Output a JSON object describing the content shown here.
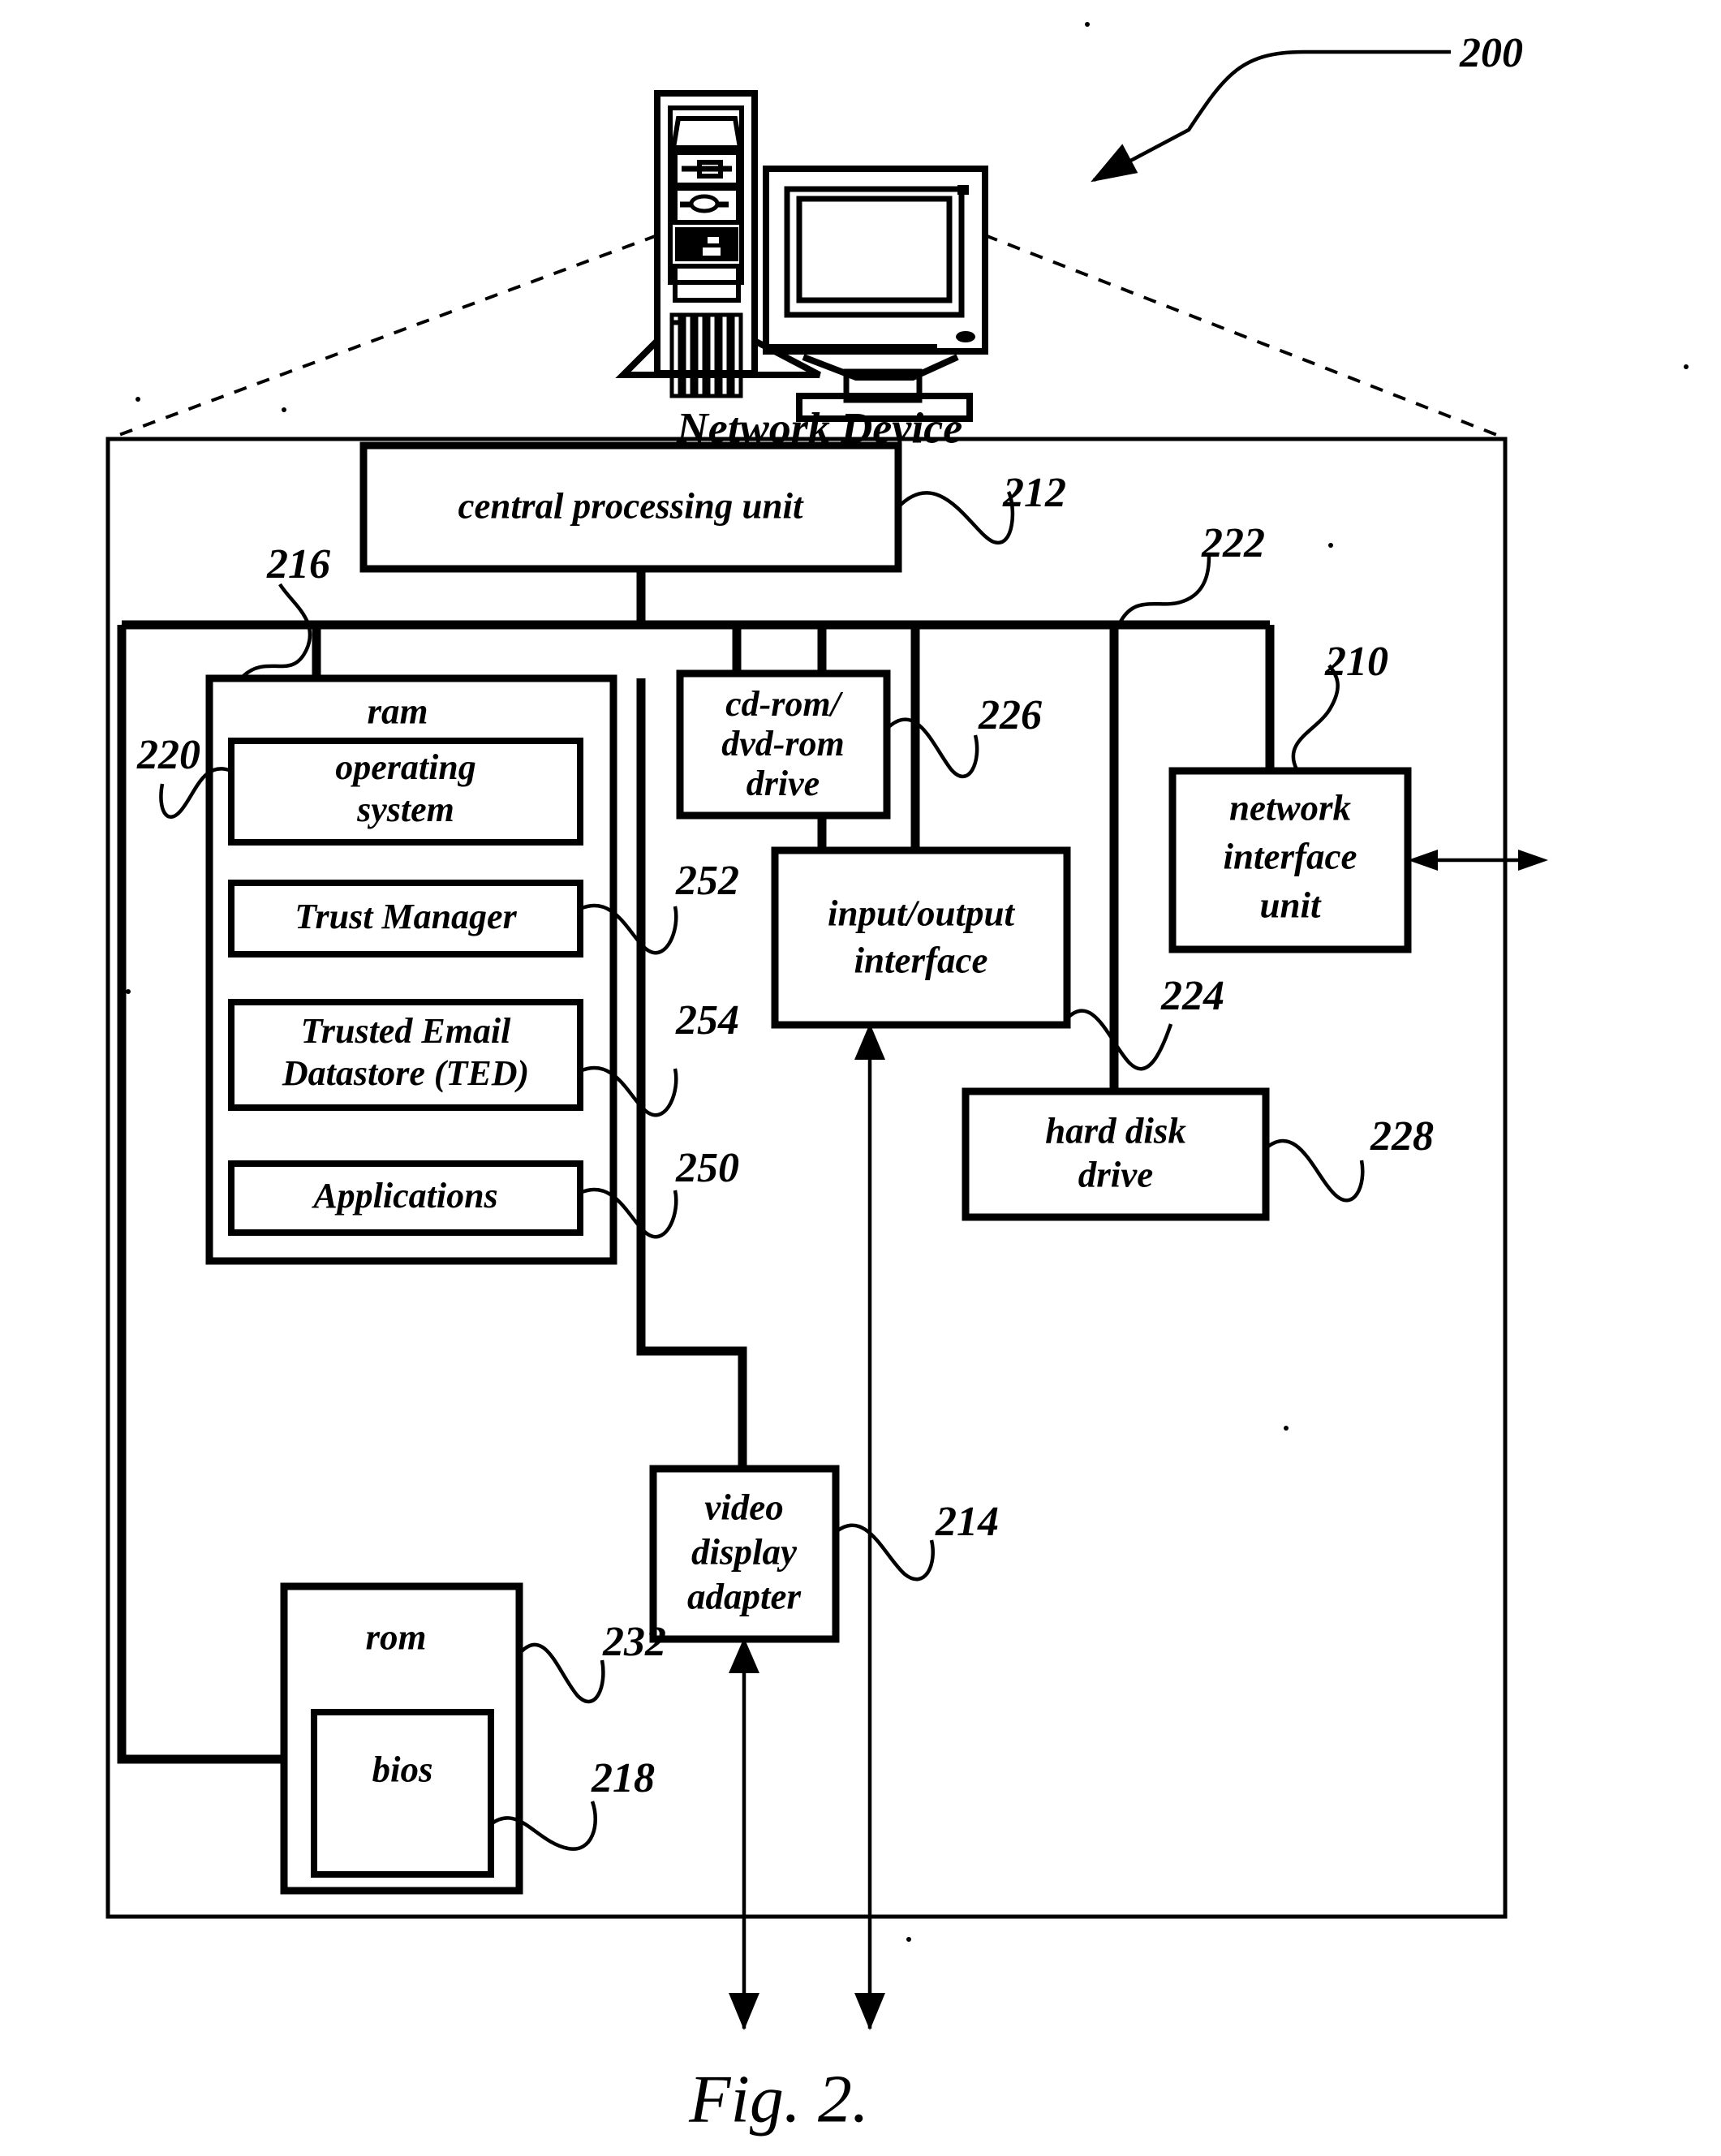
{
  "figure": {
    "caption": "Fig. 2.",
    "system_ref": "200",
    "device_label": "Network Device"
  },
  "blocks": {
    "cpu": {
      "label": "central processing unit",
      "ref": "212"
    },
    "ram": {
      "label": "ram",
      "ref": "216"
    },
    "os": {
      "label": "operating system",
      "ref": "220"
    },
    "trust": {
      "label": "Trust Manager",
      "ref": "252"
    },
    "ted": {
      "label": "Trusted Email Datastore (TED)",
      "ref": "254"
    },
    "apps": {
      "label": "Applications",
      "ref": "250"
    },
    "cdrom": {
      "label": "cd-rom/ dvd-rom drive",
      "line1": "cd-rom/",
      "line2": "dvd-rom",
      "line3": "drive",
      "ref": "226"
    },
    "io": {
      "label": "input/output interface",
      "line1": "input/output",
      "line2": "interface",
      "ref": "222"
    },
    "nic": {
      "label": "network interface unit",
      "line1": "network",
      "line2": "interface",
      "line3": "unit",
      "ref": "210"
    },
    "hdd": {
      "label": "hard disk drive",
      "line1": "hard disk",
      "line2": "drive",
      "ref": "228"
    },
    "vda": {
      "label": "video display adapter",
      "line1": "video",
      "line2": "display",
      "line3": "adapter",
      "ref": "214"
    },
    "rom": {
      "label": "rom",
      "ref": "232"
    },
    "bios": {
      "label": "bios",
      "ref": "218"
    },
    "bus_ref": {
      "ref": "224"
    }
  },
  "reference_numerals": [
    "200",
    "210",
    "212",
    "214",
    "216",
    "218",
    "220",
    "222",
    "224",
    "226",
    "228",
    "232",
    "250",
    "252",
    "254"
  ],
  "colors": {
    "ink": "#000000",
    "paper": "#ffffff"
  }
}
